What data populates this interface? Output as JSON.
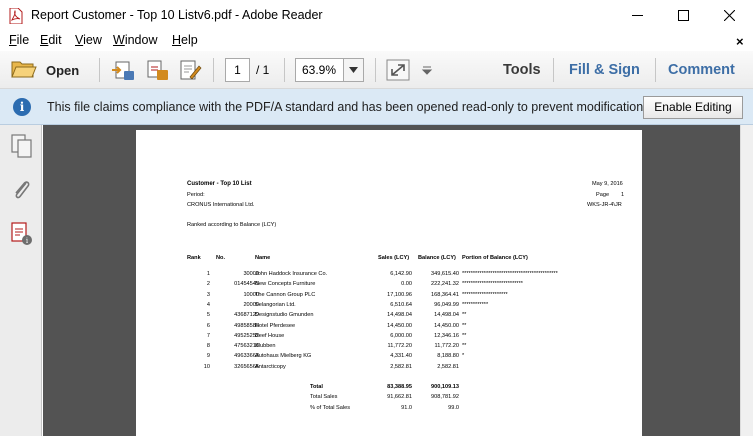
{
  "window": {
    "title": "Report Customer - Top 10 Listv6.pdf - Adobe Reader",
    "min_icon": "minimize-icon",
    "max_icon": "maximize-icon",
    "close_icon": "close-icon"
  },
  "menu": {
    "items": [
      {
        "u": "F",
        "rest": "ile"
      },
      {
        "u": "E",
        "rest": "dit"
      },
      {
        "u": "V",
        "rest": "iew"
      },
      {
        "u": "W",
        "rest": "indow"
      },
      {
        "u": "H",
        "rest": "elp"
      }
    ],
    "close_label": "×"
  },
  "toolbar": {
    "open_label": "Open",
    "current_page": "1",
    "total_pages": "/ 1",
    "zoom": "63.9%",
    "tools_label": "Tools",
    "fill_sign_label": "Fill & Sign",
    "comment_label": "Comment"
  },
  "infobar": {
    "icon": "i",
    "message": "This file claims compliance with the PDF/A standard and has been opened read-only to prevent modification.",
    "button_label": "Enable Editing"
  },
  "report": {
    "title": "Customer - Top 10 List",
    "date": "May 9, 2016",
    "period_label": "Period:",
    "page_label": "Page",
    "page_no": "1",
    "company": "CRONUS International Ltd.",
    "user": "WKS-JR-4\\JR",
    "ranked_by": "Ranked according to Balance (LCY)",
    "headers": {
      "rank": "Rank",
      "no": "No.",
      "name": "Name",
      "sales": "Sales (LCY)",
      "balance": "Balance (LCY)",
      "portion": "Portion of Balance (LCY)"
    },
    "rows": [
      {
        "rank": "1",
        "no": "30000",
        "name": "John Haddock Insurance Co.",
        "sales": "6,142.90",
        "balance": "349,615.40",
        "bar": "********************************************"
      },
      {
        "rank": "2",
        "no": "01454545",
        "name": "New Concepts Furniture",
        "sales": "0.00",
        "balance": "222,241.32",
        "bar": "****************************"
      },
      {
        "rank": "3",
        "no": "10000",
        "name": "The Cannon Group PLC",
        "sales": "17,100.96",
        "balance": "168,364.41",
        "bar": "*********************"
      },
      {
        "rank": "4",
        "no": "20000",
        "name": "Selangorian Ltd.",
        "sales": "6,510.64",
        "balance": "96,049.99",
        "bar": "************"
      },
      {
        "rank": "5",
        "no": "43687129",
        "name": "Designstudio Gmunden",
        "sales": "14,498.04",
        "balance": "14,498.04",
        "bar": "**"
      },
      {
        "rank": "6",
        "no": "49858585",
        "name": "Hotel Pferdesee",
        "sales": "14,450.00",
        "balance": "14,450.00",
        "bar": "**"
      },
      {
        "rank": "7",
        "no": "49525252",
        "name": "Beef House",
        "sales": "6,000.00",
        "balance": "12,346.16",
        "bar": "**"
      },
      {
        "rank": "8",
        "no": "47563218",
        "name": "Klubben",
        "sales": "11,772.20",
        "balance": "11,772.20",
        "bar": "**"
      },
      {
        "rank": "9",
        "no": "49633663",
        "name": "Autohaus Mielberg KG",
        "sales": "4,331.40",
        "balance": "8,188.80",
        "bar": "*"
      },
      {
        "rank": "10",
        "no": "32656565",
        "name": "Antarcticopy",
        "sales": "2,582.81",
        "balance": "2,582.81",
        "bar": ""
      }
    ],
    "totals": [
      {
        "label": "Total",
        "sales": "83,388.95",
        "balance": "900,109.13",
        "bold": true
      },
      {
        "label": "Total Sales",
        "sales": "91,662.81",
        "balance": "908,781.92",
        "bold": false
      },
      {
        "label": "% of Total Sales",
        "sales": "91.0",
        "balance": "99.0",
        "bold": false
      }
    ]
  },
  "colors": {
    "infobar_bg": "#dbe9f5",
    "info_icon": "#2c6cb0",
    "fill_sign_text": "#3d6ea6",
    "doc_bg": "#535353"
  }
}
